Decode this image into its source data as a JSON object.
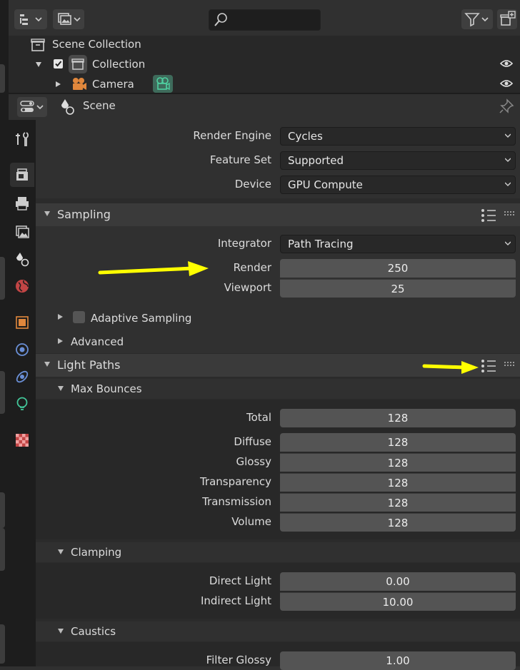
{
  "outliner": {
    "scene_collection": "Scene Collection",
    "collection": "Collection",
    "camera": "Camera"
  },
  "properties_header": {
    "context": "Scene"
  },
  "render": {
    "render_engine_label": "Render Engine",
    "render_engine": "Cycles",
    "feature_set_label": "Feature Set",
    "feature_set": "Supported",
    "device_label": "Device",
    "device": "GPU Compute"
  },
  "sampling": {
    "title": "Sampling",
    "integrator_label": "Integrator",
    "integrator": "Path Tracing",
    "render_label": "Render",
    "render": "250",
    "viewport_label": "Viewport",
    "viewport": "25",
    "adaptive_sampling": "Adaptive Sampling",
    "advanced": "Advanced"
  },
  "light_paths": {
    "title": "Light Paths",
    "max_bounces": {
      "title": "Max Bounces",
      "total_label": "Total",
      "total": "128",
      "diffuse_label": "Diffuse",
      "diffuse": "128",
      "glossy_label": "Glossy",
      "glossy": "128",
      "transparency_label": "Transparency",
      "transparency": "128",
      "transmission_label": "Transmission",
      "transmission": "128",
      "volume_label": "Volume",
      "volume": "128"
    },
    "clamping": {
      "title": "Clamping",
      "direct_label": "Direct Light",
      "direct": "0.00",
      "indirect_label": "Indirect Light",
      "indirect": "10.00"
    },
    "caustics": {
      "title": "Caustics",
      "filter_glossy_label": "Filter Glossy",
      "filter_glossy": "1.00"
    }
  },
  "colors": {
    "annotation_arrow": "#ffff00",
    "accent_blue": "#4772b3"
  }
}
